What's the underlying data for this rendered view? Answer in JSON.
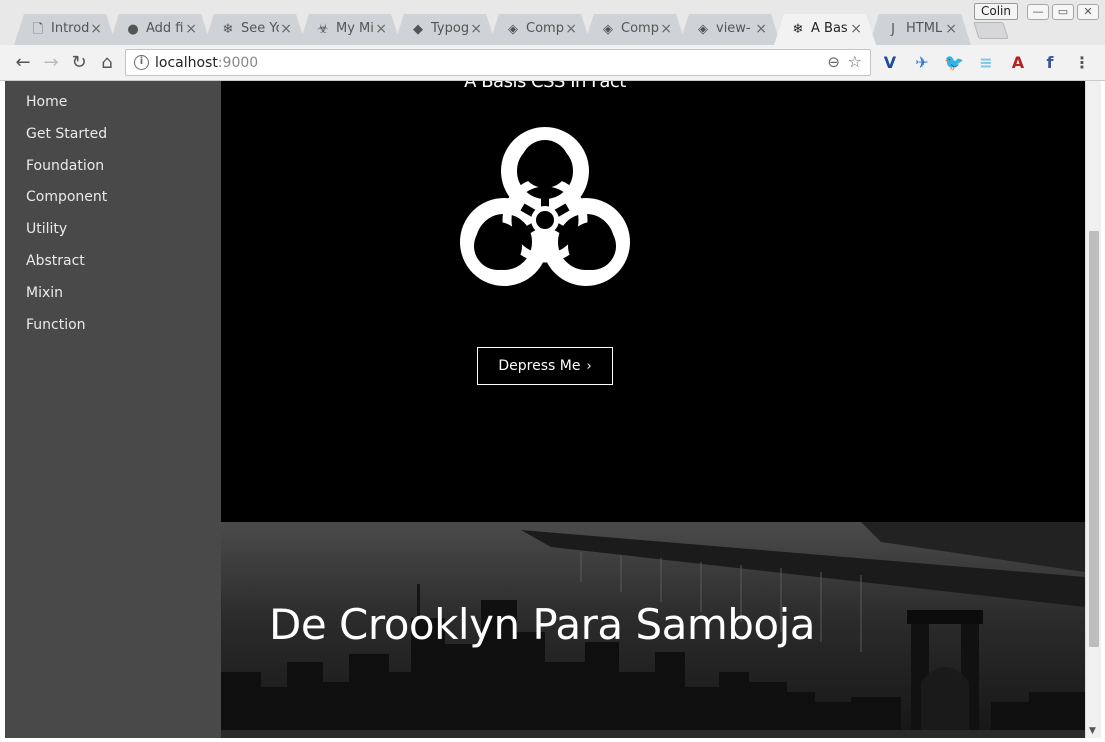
{
  "browser": {
    "tabs": [
      {
        "icon": "document-icon",
        "glyph": "🗋",
        "title": "Introd"
      },
      {
        "icon": "github-icon",
        "glyph": "●",
        "title": "Add fi"
      },
      {
        "icon": "snowflake-icon",
        "glyph": "❄",
        "title": "See Yo"
      },
      {
        "icon": "biohazard-icon",
        "glyph": "☣",
        "title": "My Mi"
      },
      {
        "icon": "typography-icon",
        "glyph": "◆",
        "title": "Typog"
      },
      {
        "icon": "component-icon",
        "glyph": "◈",
        "title": "Comp"
      },
      {
        "icon": "component-icon",
        "glyph": "◈",
        "title": "Comp"
      },
      {
        "icon": "component-icon",
        "glyph": "◈",
        "title": "view-"
      },
      {
        "icon": "snowflake-icon",
        "glyph": "❄",
        "title": "A Bas"
      },
      {
        "icon": "html-icon",
        "glyph": "J",
        "title": "HTML"
      }
    ],
    "close_glyph": "×",
    "profile_name": "Colin",
    "window_buttons": {
      "minimize": "—",
      "maximize": "▭",
      "close": "✕"
    },
    "url_host": "localhost",
    "url_port": ":9000",
    "nav": {
      "back": "←",
      "forward": "→",
      "reload": "↻",
      "home": "⌂"
    },
    "omnibox_icons": {
      "info": "i",
      "zoom": "⊖",
      "star": "☆"
    },
    "extensions": [
      {
        "name": "vimium-icon",
        "glyph": "V",
        "color": "#1f4e99"
      },
      {
        "name": "bird-icon",
        "glyph": "✈",
        "color": "#3a7bd5"
      },
      {
        "name": "twitter-icon",
        "glyph": "🐦",
        "color": "#1da1f2"
      },
      {
        "name": "stripes-icon",
        "glyph": "≡",
        "color": "#7cc6e8"
      },
      {
        "name": "font-icon",
        "glyph": "A",
        "color": "#b22222"
      },
      {
        "name": "facebook-icon",
        "glyph": "f",
        "color": "#3b5998"
      },
      {
        "name": "menu-icon",
        "glyph": "⋮",
        "color": "#555555"
      }
    ]
  },
  "sidebar": {
    "items": [
      "Home",
      "Get Started",
      "Foundation",
      "Component",
      "Utility",
      "Abstract",
      "Mixin",
      "Function"
    ]
  },
  "hero": {
    "title": "A Basis CSS In Fact",
    "cta_label": "Depress Me",
    "cta_chevron": "›"
  },
  "banner": {
    "title": "De Crooklyn Para Samboja"
  },
  "colors": {
    "sidebar_bg": "#494949",
    "hero_bg": "#000000",
    "text": "#ffffff"
  }
}
